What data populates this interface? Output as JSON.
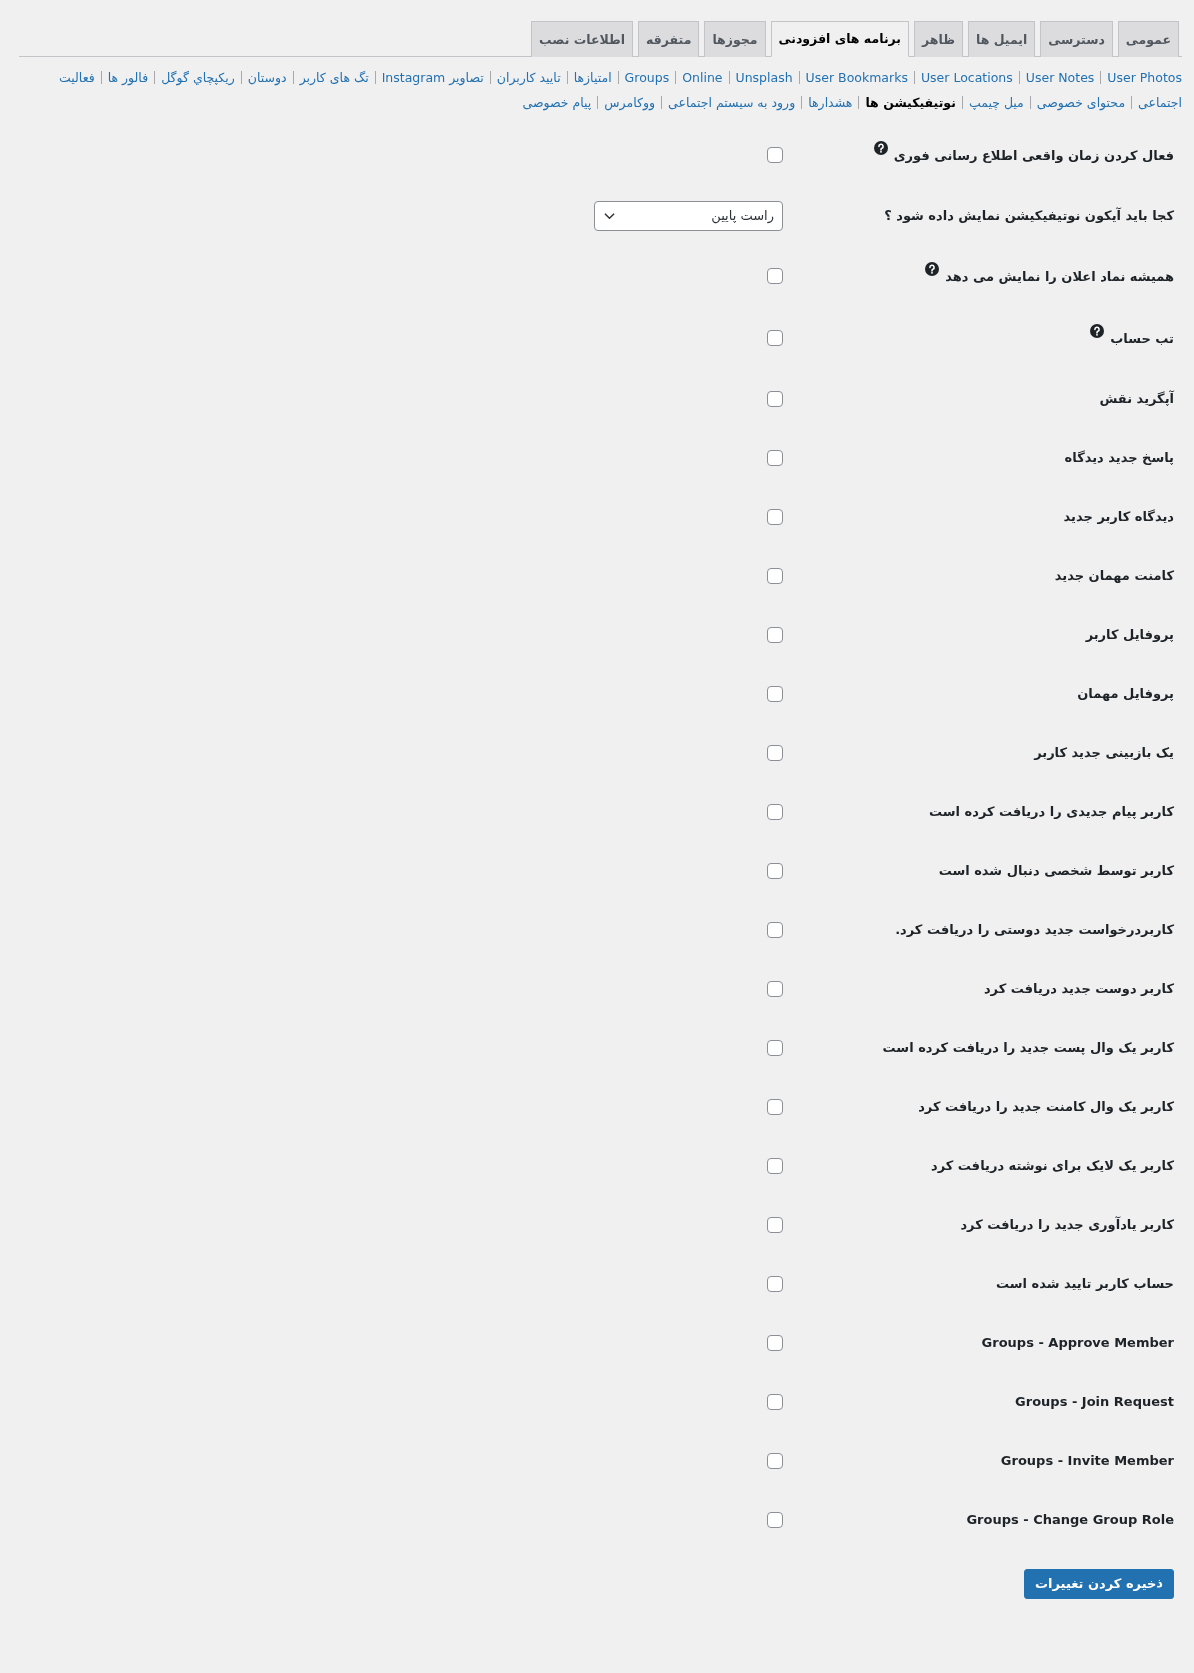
{
  "tabs": [
    {
      "label": "عمومی",
      "selected": false
    },
    {
      "label": "دسترسی",
      "selected": false
    },
    {
      "label": "ایمیل ها",
      "selected": false
    },
    {
      "label": "ظاهر",
      "selected": false
    },
    {
      "label": "برنامه های افزودنی",
      "selected": true
    },
    {
      "label": "مجوزها",
      "selected": false
    },
    {
      "label": "متفرقه",
      "selected": false
    },
    {
      "label": "اطلاعات نصب",
      "selected": false
    }
  ],
  "sub_nav": {
    "lines": [
      {
        "links": [
          {
            "label": "User Photos",
            "selected": false
          },
          {
            "label": "User Notes",
            "selected": false
          },
          {
            "label": "User Locations",
            "selected": false
          },
          {
            "label": "User Bookmarks",
            "selected": false
          },
          {
            "label": "Unsplash",
            "selected": false
          },
          {
            "label": "Online",
            "selected": false
          },
          {
            "label": "Groups",
            "selected": false
          },
          {
            "label": "امتیازها",
            "selected": false
          },
          {
            "label": "تایید کاربران",
            "selected": false
          },
          {
            "label": "تصاویر Instagram",
            "selected": false
          },
          {
            "label": "تگ های کاربر",
            "selected": false
          },
          {
            "label": "دوستان",
            "selected": false
          },
          {
            "label": "ریکپچاي گوگل",
            "selected": false
          },
          {
            "label": "فالور ها",
            "selected": false
          },
          {
            "label": "فعالیت",
            "selected": false
          }
        ]
      },
      {
        "links": [
          {
            "label": "اجتماعی",
            "selected": false
          },
          {
            "label": "محتوای خصوصی",
            "selected": false
          },
          {
            "label": "میل چیمپ",
            "selected": false
          },
          {
            "label": "نوتیفیکیشن ها",
            "selected": true
          },
          {
            "label": "هشدارها",
            "selected": false
          },
          {
            "label": "ورود به سیستم اجتماعی",
            "selected": false
          },
          {
            "label": "ووکامرس",
            "selected": false
          },
          {
            "label": "پیام خصوصی",
            "selected": false
          }
        ]
      }
    ]
  },
  "settings": [
    {
      "kind": "checkbox",
      "label": "فعال کردن زمان واقعی اطلاع رسانی فوری",
      "help": true,
      "checked": false
    },
    {
      "kind": "select",
      "label": "کجا باید آیکون نوتیفیکیشن نمایش داده شود ؟",
      "help": false,
      "value": "راست پایین"
    },
    {
      "kind": "checkbox",
      "label": "همیشه نماد اعلان را نمایش می دهد",
      "help": true,
      "checked": false
    },
    {
      "kind": "checkbox",
      "label": "تب حساب",
      "help": true,
      "checked": false
    },
    {
      "kind": "checkbox",
      "label": "آپگرید نقش",
      "help": false,
      "checked": false
    },
    {
      "kind": "checkbox",
      "label": "پاسخ جدید دیدگاه",
      "help": false,
      "checked": false
    },
    {
      "kind": "checkbox",
      "label": "دیدگاه کاربر جدید",
      "help": false,
      "checked": false
    },
    {
      "kind": "checkbox",
      "label": "کامنت مهمان جدید",
      "help": false,
      "checked": false
    },
    {
      "kind": "checkbox",
      "label": "پروفایل کاربر",
      "help": false,
      "checked": false
    },
    {
      "kind": "checkbox",
      "label": "پروفایل مهمان",
      "help": false,
      "checked": false
    },
    {
      "kind": "checkbox",
      "label": "یک بازبینی جدید کاربر",
      "help": false,
      "checked": false
    },
    {
      "kind": "checkbox",
      "label": "کاربر پیام جدیدی را دریافت کرده است",
      "help": false,
      "checked": false
    },
    {
      "kind": "checkbox",
      "label": "کاربر توسط شخصی دنبال شده است",
      "help": false,
      "checked": false
    },
    {
      "kind": "checkbox",
      "label": "کاربردرخواست جدید دوستی را دریافت کرد.",
      "help": false,
      "checked": false
    },
    {
      "kind": "checkbox",
      "label": "کاربر دوست جدید دریافت کرد",
      "help": false,
      "checked": false
    },
    {
      "kind": "checkbox",
      "label": "کاربر یک وال پست جدید را دریافت کرده است",
      "help": false,
      "checked": false
    },
    {
      "kind": "checkbox",
      "label": "کاربر یک وال کامنت جدید را دریافت کرد",
      "help": false,
      "checked": false
    },
    {
      "kind": "checkbox",
      "label": "کاربر یک لایک برای نوشته دریافت کرد",
      "help": false,
      "checked": false
    },
    {
      "kind": "checkbox",
      "label": "کاربر یادآوری جدید را دریافت کرد",
      "help": false,
      "checked": false
    },
    {
      "kind": "checkbox",
      "label": "حساب کاربر تایید شده است",
      "help": false,
      "checked": false
    },
    {
      "kind": "checkbox",
      "label": "Groups - Approve Member",
      "help": false,
      "checked": false
    },
    {
      "kind": "checkbox",
      "label": "Groups - Join Request",
      "help": false,
      "checked": false
    },
    {
      "kind": "checkbox",
      "label": "Groups - Invite Member",
      "help": false,
      "checked": false
    },
    {
      "kind": "checkbox",
      "label": "Groups - Change Group Role",
      "help": false,
      "checked": false
    }
  ],
  "save_button": "ذخیره کردن تغییرات"
}
